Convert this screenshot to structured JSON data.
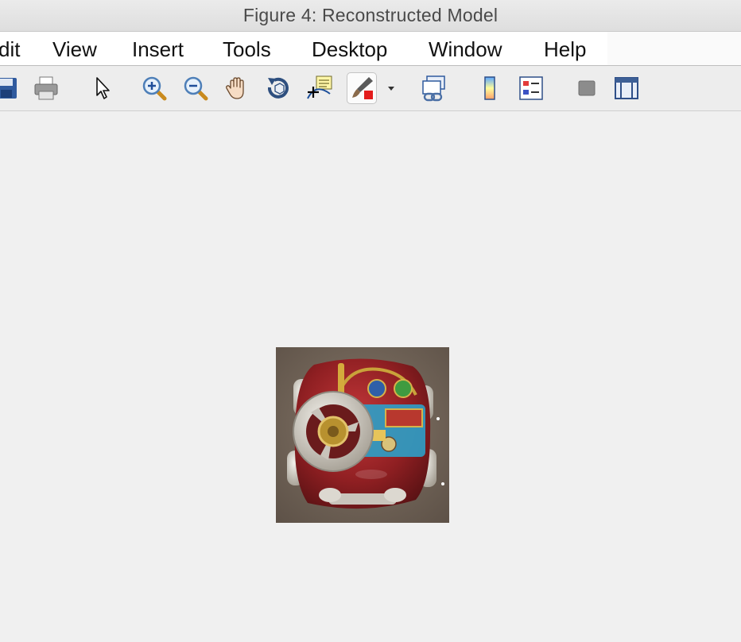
{
  "window": {
    "title": "Figure 4: Reconstructed Model"
  },
  "menubar": {
    "items": [
      {
        "label": "dit"
      },
      {
        "label": "View"
      },
      {
        "label": "Insert"
      },
      {
        "label": "Tools"
      },
      {
        "label": "Desktop"
      },
      {
        "label": "Window"
      },
      {
        "label": "Help"
      }
    ]
  },
  "toolbar": {
    "buttons": [
      {
        "icon": "save-icon"
      },
      {
        "icon": "print-icon"
      },
      {
        "icon": "pointer-icon"
      },
      {
        "icon": "zoom-in-icon"
      },
      {
        "icon": "zoom-out-icon"
      },
      {
        "icon": "pan-hand-icon"
      },
      {
        "icon": "rotate-3d-icon"
      },
      {
        "icon": "data-cursor-icon"
      },
      {
        "icon": "brush-icon",
        "pressed": true
      },
      {
        "icon": "dropdown-arrow-icon"
      },
      {
        "icon": "link-plot-icon"
      },
      {
        "icon": "colorbar-icon"
      },
      {
        "icon": "legend-icon"
      },
      {
        "icon": "hide-plot-tools-icon"
      },
      {
        "icon": "show-plot-tools-icon"
      }
    ]
  },
  "figure": {
    "image": "toy-car-reconstruction"
  }
}
